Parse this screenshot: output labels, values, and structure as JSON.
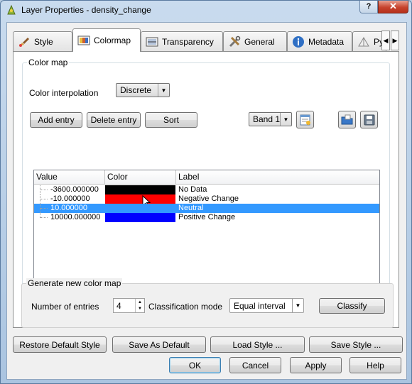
{
  "window": {
    "title": "Layer Properties - density_change",
    "help_label": "?",
    "close_label": "✕"
  },
  "tabs": [
    {
      "label": "Style",
      "icon": "paintbrush-icon"
    },
    {
      "label": "Colormap",
      "icon": "colormap-icon",
      "active": true
    },
    {
      "label": "Transparency",
      "icon": "transparency-icon"
    },
    {
      "label": "General",
      "icon": "tools-icon"
    },
    {
      "label": "Metadata",
      "icon": "info-icon"
    },
    {
      "label": "Py",
      "icon": "pyramid-icon"
    }
  ],
  "tab_nav": {
    "prev": "◀",
    "next": "▶"
  },
  "color_map": {
    "group_title": "Color map",
    "interpolation_label": "Color interpolation",
    "interpolation_value": "Discrete",
    "add_entry": "Add entry",
    "delete_entry": "Delete entry",
    "sort": "Sort",
    "band_value": "Band 1",
    "columns": [
      "Value",
      "Color",
      "Label"
    ],
    "entries": [
      {
        "value": "-3600.000000",
        "color": "#000000",
        "label": "No Data"
      },
      {
        "value": "-10.000000",
        "color": "#ff0000",
        "label": "Negative Change"
      },
      {
        "value": "10.000000",
        "color": "#3399ff",
        "label": "Neutral",
        "selected": true
      },
      {
        "value": "10000.000000",
        "color": "#0000ff",
        "label": "Positive Change"
      }
    ]
  },
  "generate": {
    "group_title": "Generate new color map",
    "entries_label": "Number of entries",
    "entries_value": "4",
    "mode_label": "Classification mode",
    "mode_value": "Equal interval",
    "classify": "Classify"
  },
  "style_buttons": {
    "restore": "Restore Default Style",
    "save_default": "Save As Default",
    "load": "Load Style ...",
    "save": "Save Style ..."
  },
  "dialog_buttons": {
    "ok": "OK",
    "cancel": "Cancel",
    "apply": "Apply",
    "help": "Help"
  }
}
